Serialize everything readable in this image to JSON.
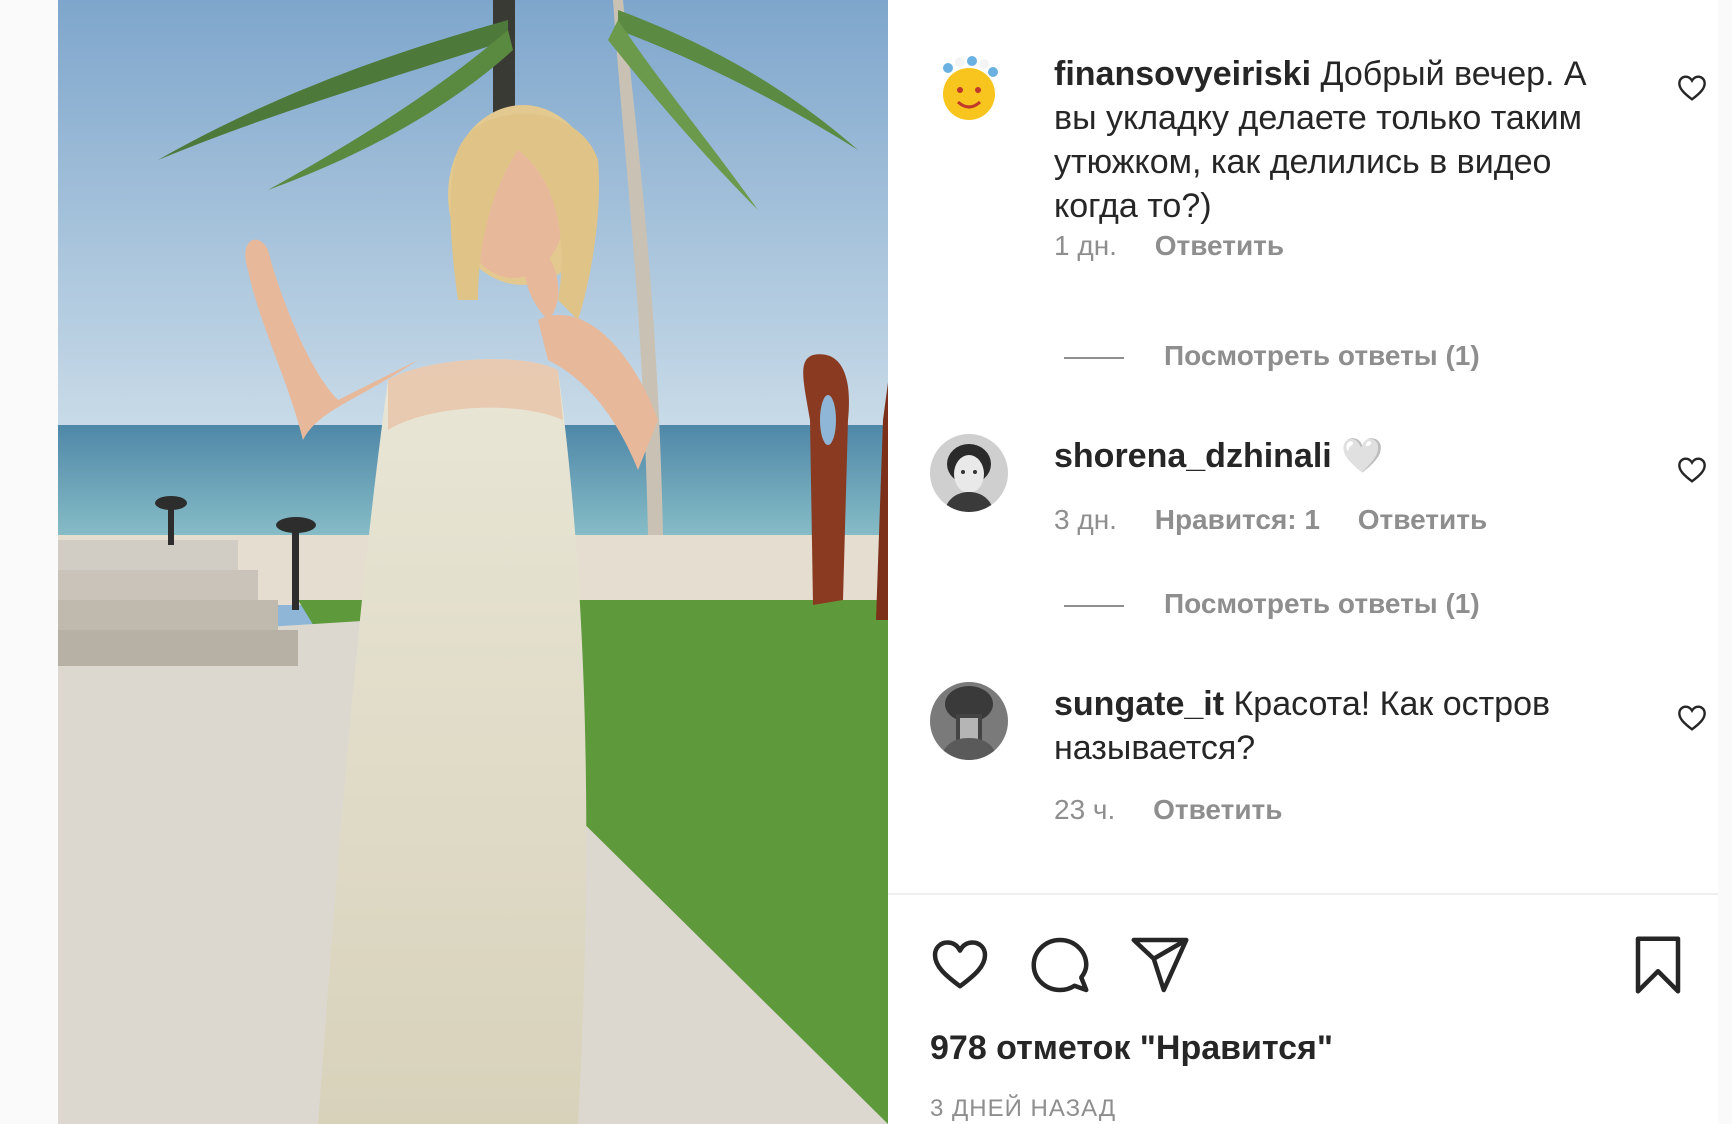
{
  "comments": [
    {
      "username": "finansovyeiriski",
      "text": "Добрый вечер. А вы укладку делаете только таким утюжком, как делились в видео когда то?)",
      "time": "1 дн.",
      "likes": "",
      "reply": "Ответить",
      "view_replies": "Посмотреть ответы (1)",
      "avatar_icon": "sun-avatar-icon"
    },
    {
      "username": "shorena_dzhinali",
      "text": "🤍",
      "time": "3 дн.",
      "likes": "Нравится: 1",
      "reply": "Ответить",
      "view_replies": "Посмотреть ответы (1)",
      "avatar_icon": "portrait-avatar-icon"
    },
    {
      "username": "sungate_it",
      "text": "Красота! Как остров называется?",
      "time": "23 ч.",
      "likes": "",
      "reply": "Ответить",
      "view_replies": "",
      "avatar_icon": "book-avatar-icon"
    }
  ],
  "actions": {
    "like_icon": "heart-icon",
    "comment_icon": "comment-icon",
    "share_icon": "paper-plane-icon",
    "save_icon": "bookmark-icon"
  },
  "likes_count": "978 отметок \"Нравится\"",
  "time_ago": "3 ДНЕЙ НАЗАД",
  "colors": {
    "text": "#262626",
    "muted": "#8e8e8e",
    "divider": "#efefef"
  }
}
